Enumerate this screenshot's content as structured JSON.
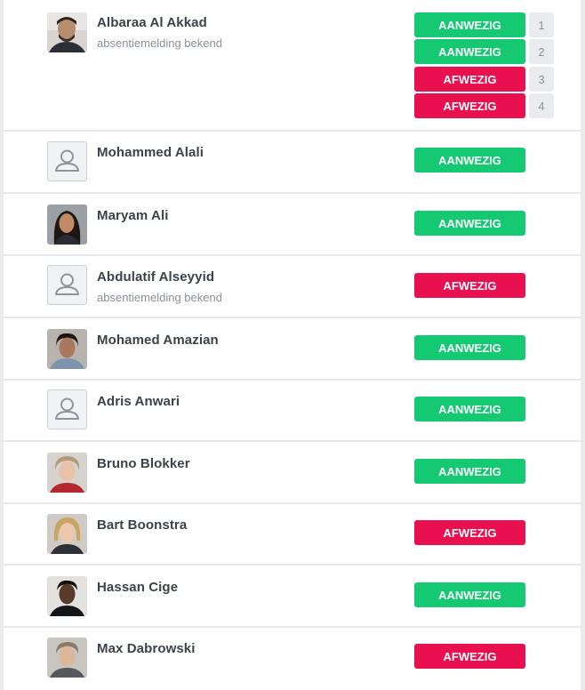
{
  "students": [
    {
      "name": "Albaraa Al Akkad",
      "note": "absentiemelding bekend",
      "avatar": "photo",
      "periods": [
        {
          "label": "AANWEZIG",
          "state": "present",
          "number": "1"
        },
        {
          "label": "AANWEZIG",
          "state": "present",
          "number": "2"
        },
        {
          "label": "AFWEZIG",
          "state": "absent",
          "number": "3"
        },
        {
          "label": "AFWEZIG",
          "state": "absent",
          "number": "4"
        }
      ]
    },
    {
      "name": "Mohammed Alali",
      "avatar": "placeholder",
      "status": {
        "label": "AANWEZIG",
        "state": "present"
      }
    },
    {
      "name": "Maryam Ali",
      "avatar": "photo",
      "status": {
        "label": "AANWEZIG",
        "state": "present"
      }
    },
    {
      "name": "Abdulatif Alseyyid",
      "note": "absentiemelding bekend",
      "avatar": "placeholder",
      "status": {
        "label": "AFWEZIG",
        "state": "absent"
      }
    },
    {
      "name": "Mohamed Amazian",
      "avatar": "photo",
      "status": {
        "label": "AANWEZIG",
        "state": "present"
      }
    },
    {
      "name": "Adris Anwari",
      "avatar": "placeholder",
      "status": {
        "label": "AANWEZIG",
        "state": "present"
      }
    },
    {
      "name": "Bruno Blokker",
      "avatar": "photo",
      "status": {
        "label": "AANWEZIG",
        "state": "present"
      }
    },
    {
      "name": "Bart Boonstra",
      "avatar": "photo",
      "status": {
        "label": "AFWEZIG",
        "state": "absent"
      }
    },
    {
      "name": "Hassan Cige",
      "avatar": "photo",
      "status": {
        "label": "AANWEZIG",
        "state": "present"
      }
    },
    {
      "name": "Max Dabrowski",
      "avatar": "photo",
      "status": {
        "label": "AFWEZIG",
        "state": "absent"
      }
    }
  ],
  "colors": {
    "present": "#14c971",
    "absent": "#e8104f",
    "name": "#3d4148",
    "note": "#8c9097"
  },
  "icons": {
    "placeholder": "user-silhouette-icon"
  }
}
